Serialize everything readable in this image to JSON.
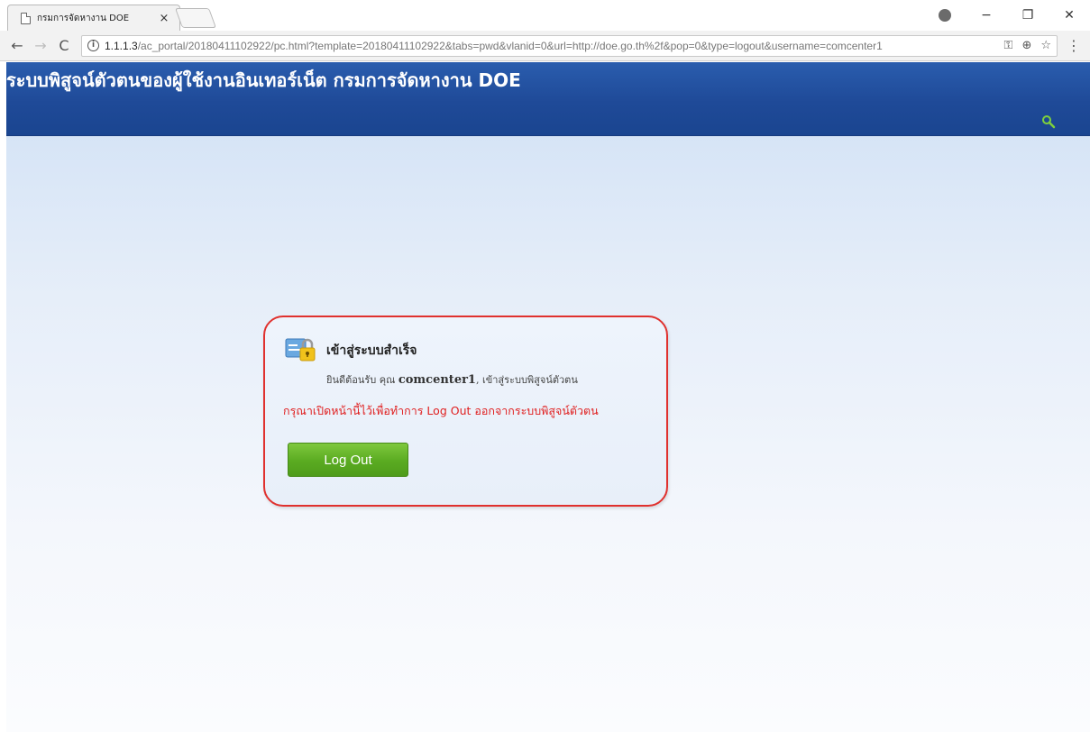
{
  "browser": {
    "tab_title": "กรมการจัดหางาน DOE",
    "tab_close": "×",
    "url_host": "1.1.1.3",
    "url_path": "/ac_portal/20180411102922/pc.html?template=20180411102922&tabs=pwd&vlanid=0&url=http://doe.go.th%2f&pop=0&type=logout&username=comcenter1",
    "window_controls": {
      "minimize": "−",
      "restore": "❐",
      "close": "✕"
    },
    "nav": {
      "back": "←",
      "forward": "→",
      "reload": "C"
    },
    "omni_icons": {
      "key": "⚿",
      "zoom": "⊕",
      "star": "☆"
    },
    "menu": "⋮"
  },
  "header": {
    "site_title": "ระบบพิสูจน์ตัวตนของผู้ใช้งานอินเทอร์เน็ต กรมการจัดหางาน DOE"
  },
  "card": {
    "title": "เข้าสู่ระบบสำเร็จ",
    "welcome_prefix": "ยินดีต้อนรับ คุณ ",
    "username": "comcenter1",
    "welcome_suffix": ", เข้าสู่ระบบพิสูจน์ตัวตน",
    "warning": "กรุณาเปิดหน้านี้ไว้เพื่อทำการ Log Out ออกจากระบบพิสูจน์ตัวตน",
    "logout_label": "Log Out"
  },
  "colors": {
    "header_blue": "#1f4a98",
    "card_border": "#e0312e",
    "warning_red": "#e02020",
    "button_green": "#5aab21"
  }
}
